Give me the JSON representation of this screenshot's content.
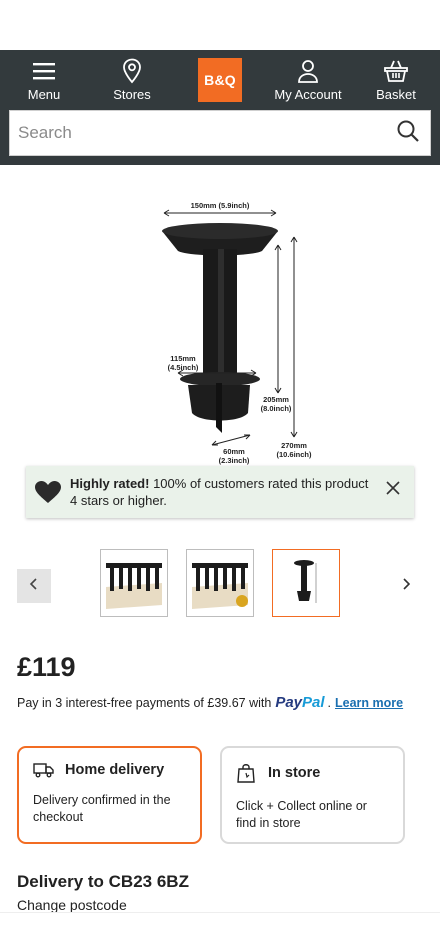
{
  "header": {
    "nav": {
      "menu_label": "Menu",
      "stores_label": "Stores",
      "logo_text": "B&Q",
      "account_label": "My Account",
      "basket_label": "Basket"
    },
    "search": {
      "placeholder": "Search"
    }
  },
  "product_image": {
    "dimensions": {
      "top_width": "150mm (5.9inch)",
      "mid_width_1": "115mm",
      "mid_width_2": "(4.5inch)",
      "blade_height_1": "205mm",
      "blade_height_2": "(8.0inch)",
      "total_height_1": "270mm",
      "total_height_2": "(10.6inch)",
      "base_width_1": "60mm",
      "base_width_2": "(2.3inch)"
    }
  },
  "rating_banner": {
    "bold_text": "Highly rated!",
    "text": " 100% of customers rated this product 4 stars or higher."
  },
  "gallery": {
    "thumbnails": [
      "thumbnail-1",
      "thumbnail-2",
      "thumbnail-3"
    ],
    "active_index": 2
  },
  "price": {
    "amount": "£119",
    "pay_prefix": "Pay in 3 interest-free payments of £39.67 with",
    "paypal_part1": "Pay",
    "paypal_part2": "Pal",
    "pay_suffix": ".",
    "learn_more": "Learn more"
  },
  "fulfilment": {
    "home": {
      "title": "Home delivery",
      "desc": "Delivery confirmed in the checkout"
    },
    "store": {
      "title": "In store",
      "desc": "Click + Collect online or find in store"
    }
  },
  "delivery": {
    "title": "Delivery to CB23 6BZ",
    "change": "Change postcode"
  },
  "colors": {
    "header_bg": "#333a3d",
    "brand_orange": "#f26c23",
    "banner_bg": "#eaf2ea",
    "link_blue": "#1a6fb0"
  }
}
